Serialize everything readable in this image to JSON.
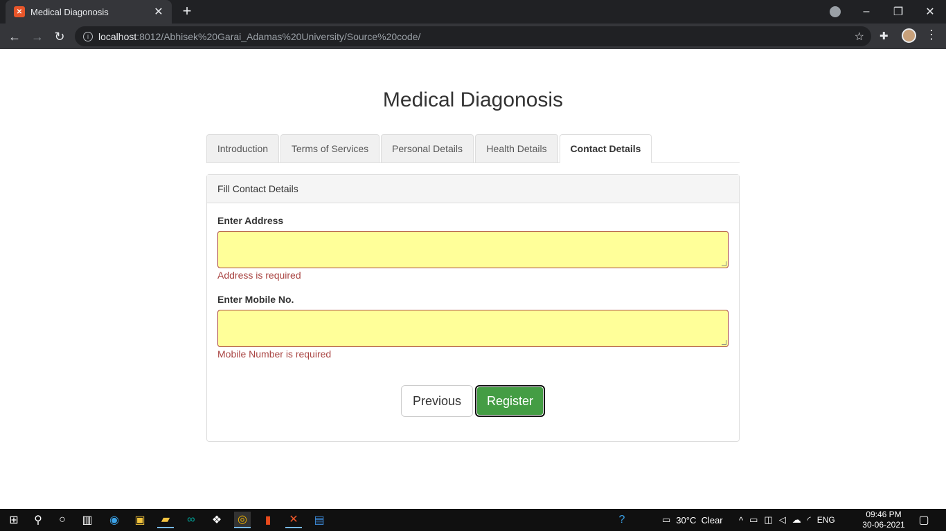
{
  "browser": {
    "tab_title": "Medical Diagonosis",
    "tab_close": "✕",
    "new_tab": "+",
    "url_host": "localhost",
    "url_path": ":8012/Abhisek%20Garai_Adamas%20University/Source%20code/",
    "window_controls": {
      "minimize": "–",
      "restore": "❐",
      "close": "✕"
    }
  },
  "page": {
    "title": "Medical Diagonosis",
    "tabs": [
      {
        "label": "Introduction"
      },
      {
        "label": "Terms of Services"
      },
      {
        "label": "Personal Details"
      },
      {
        "label": "Health Details"
      },
      {
        "label": "Contact Details"
      }
    ],
    "active_tab": "Contact Details",
    "panel_heading": "Fill Contact Details",
    "fields": {
      "address": {
        "label": "Enter Address",
        "value": "",
        "error": "Address is required"
      },
      "mobile": {
        "label": "Enter Mobile No.",
        "value": "",
        "error": "Mobile Number is required"
      }
    },
    "buttons": {
      "previous": "Previous",
      "register": "Register"
    }
  },
  "taskbar": {
    "weather": "30°C  Clear",
    "language": "ENG",
    "time": "09:46 PM",
    "date": "30-06-2021"
  },
  "colors": {
    "input_bg": "#ffff99",
    "error": "#a94442",
    "register_btn": "#449d44"
  }
}
